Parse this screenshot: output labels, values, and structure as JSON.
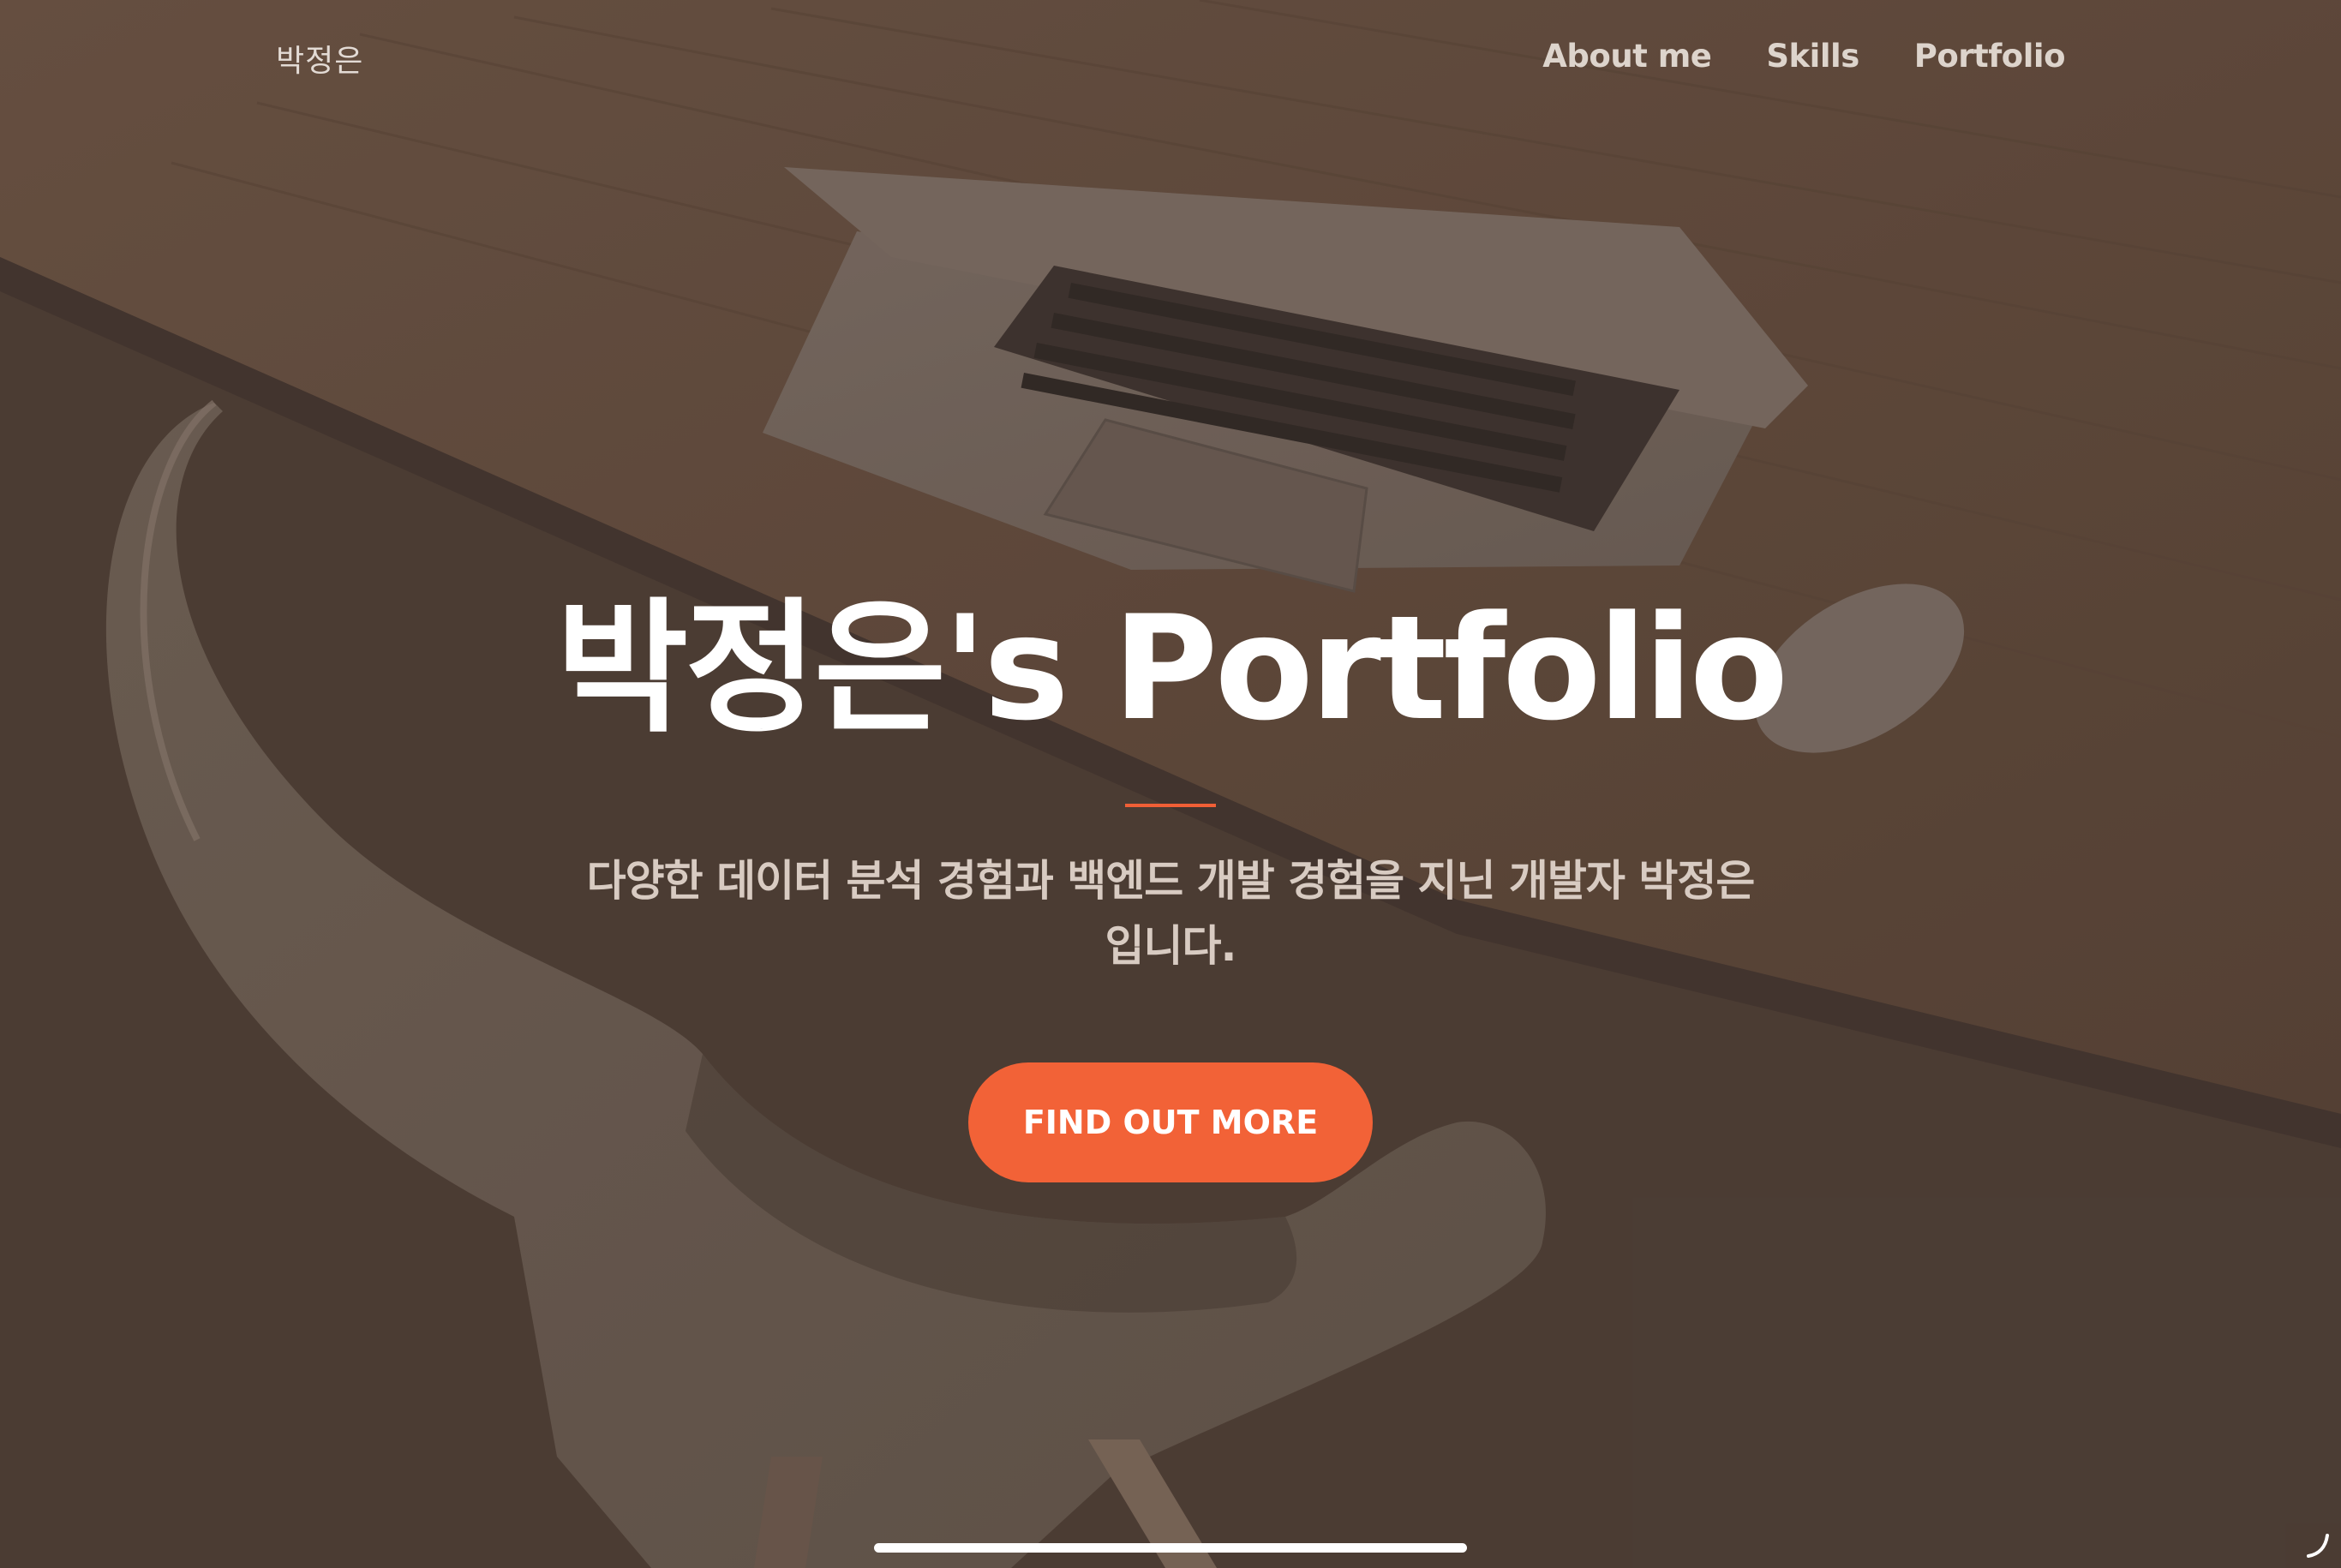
{
  "navbar": {
    "brand": "박정은",
    "links": [
      "About me",
      "Skills",
      "Portfolio"
    ]
  },
  "hero": {
    "title": "박정은's Portfolio",
    "subtitle": "다양한 데이터 분석 경험과 백엔드 개발 경험을 지닌 개발자 박정은입니다.",
    "cta_label": "FIND OUT MORE"
  },
  "colors": {
    "accent": "#f26237",
    "background": "#4e4038",
    "title_text": "#ffffff",
    "subtitle_text": "#d8cbc2"
  },
  "icons": {
    "corner": "scroll-indicator-icon"
  }
}
